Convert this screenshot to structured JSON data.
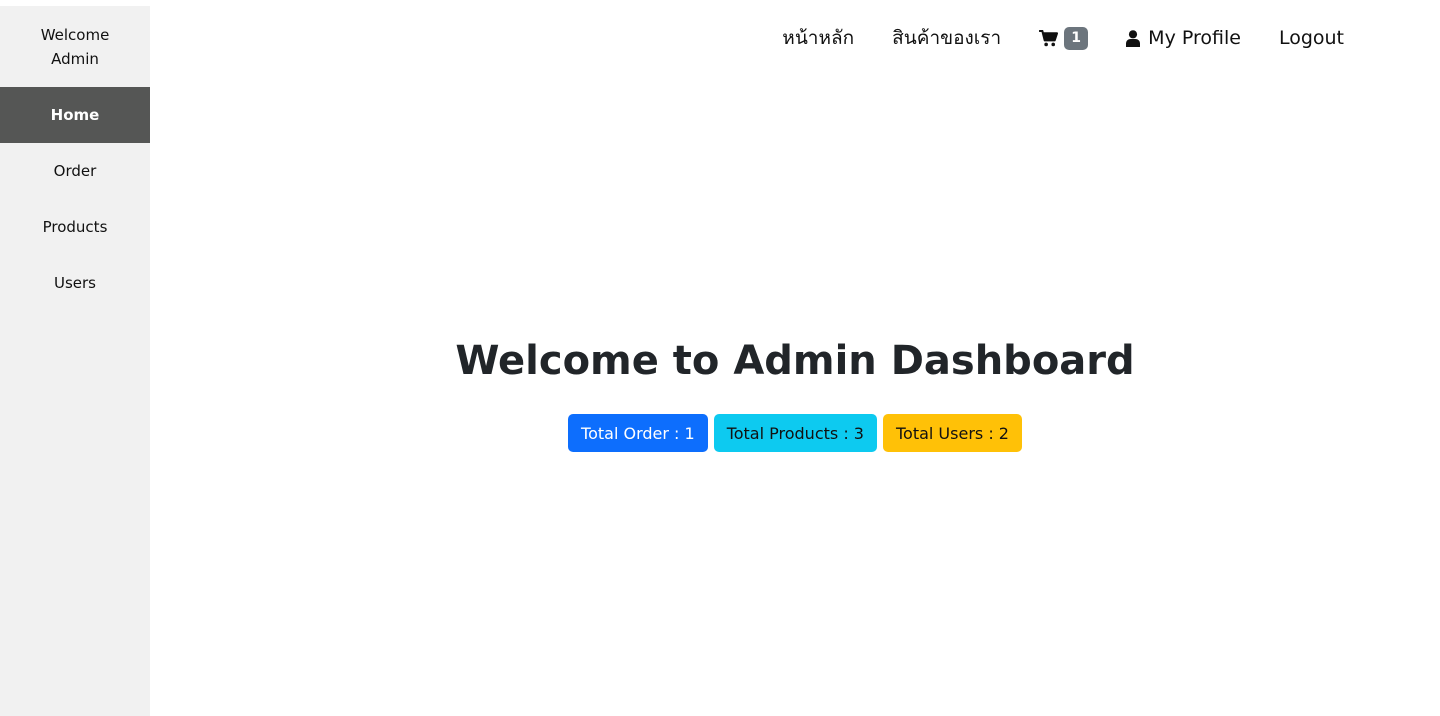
{
  "sidebar": {
    "welcome_line1": "Welcome",
    "welcome_line2": "Admin",
    "items": [
      {
        "label": "Home",
        "active": true
      },
      {
        "label": "Order"
      },
      {
        "label": "Products"
      },
      {
        "label": "Users"
      }
    ]
  },
  "nav": {
    "home": "หน้าหลัก",
    "products": "สินค้าของเรา",
    "cart_icon": "shopping-cart-icon",
    "cart_count": "1",
    "profile_icon": "user-icon",
    "profile": "My Profile",
    "logout": "Logout"
  },
  "main": {
    "title": "Welcome to Admin Dashboard",
    "stats": {
      "orders": "Total Order : 1",
      "products": "Total Products : 3",
      "users": "Total Users : 2"
    }
  },
  "colors": {
    "sidebar_bg": "#f1f1f1",
    "sidebar_active": "#555655",
    "badge": "#6c757d",
    "primary": "#0d6efd",
    "info": "#0dcaf0",
    "warning": "#ffc107"
  }
}
